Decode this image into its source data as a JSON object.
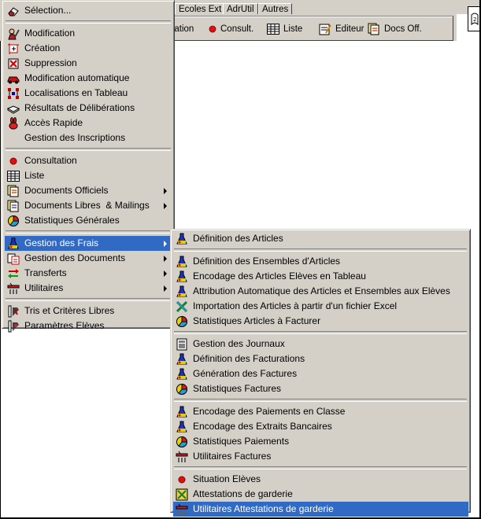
{
  "tabs": [
    {
      "label": "Ecoles Ext"
    },
    {
      "label": "AdrUtil"
    },
    {
      "label": "Autres"
    }
  ],
  "toolbar": {
    "creation_label": "éation",
    "consult_label": "Consult.",
    "liste_label": "Liste",
    "editeur_label": "Editeur",
    "docsoff_label": "Docs Off."
  },
  "main_menu": {
    "items": [
      {
        "label": "Sélection...",
        "icon": "eraser-icon"
      },
      {
        "label": "Modification",
        "icon": "modify-icon"
      },
      {
        "label": "Création",
        "icon": "create-icon"
      },
      {
        "label": "Suppression",
        "icon": "delete-icon"
      },
      {
        "label": "Modification automatique",
        "icon": "car-icon"
      },
      {
        "label": "Localisations en Tableau",
        "icon": "grid-location-icon"
      },
      {
        "label": "Résultats de Délibérations",
        "icon": "book-icon"
      },
      {
        "label": "Accès Rapide",
        "icon": "rabbit-icon"
      },
      {
        "label": "Gestion des Inscriptions",
        "icon": ""
      },
      {
        "label": "Consultation",
        "icon": "red-dot-icon"
      },
      {
        "label": "Liste",
        "icon": "list-icon"
      },
      {
        "label": "Documents Officiels",
        "icon": "documents-icon"
      },
      {
        "label": "Documents Libres  & Mailings",
        "icon": "documents-icon"
      },
      {
        "label": "Statistiques Générales",
        "icon": "pie-chart-icon"
      },
      {
        "label": "Gestion des Frais",
        "icon": "flask-icon"
      },
      {
        "label": "Gestion des Documents",
        "icon": "doc-manage-icon"
      },
      {
        "label": "Transferts",
        "icon": "transfer-arrows-icon"
      },
      {
        "label": "Utilitaires",
        "icon": "tools-icon"
      },
      {
        "label": "Tris et Critères Libres",
        "icon": "sort-icon"
      },
      {
        "label": "Paramètres Elèves",
        "icon": "settings-icon"
      }
    ]
  },
  "sub_menu": {
    "items": [
      {
        "label": "Définition des Articles",
        "icon": "flask-icon"
      },
      {
        "label": "Définition des Ensembles d'Articles",
        "icon": "flask-icon"
      },
      {
        "label": "Encodage des Articles Elèves en Tableau",
        "icon": "flask-icon"
      },
      {
        "label": "Attribution Automatique des Articles et Ensembles aux Elèves",
        "icon": "flask-icon"
      },
      {
        "label": "Importation des Articles à partir d'un fichier Excel",
        "icon": "excel-icon"
      },
      {
        "label": "Statistiques Articles à Facturer",
        "icon": "pie-chart-icon"
      },
      {
        "label": "Gestion des Journaux",
        "icon": "journal-icon"
      },
      {
        "label": "Définition des Facturations",
        "icon": "flask-icon"
      },
      {
        "label": "Génération des Factures",
        "icon": "flask-icon"
      },
      {
        "label": "Statistiques Factures",
        "icon": "pie-chart-icon"
      },
      {
        "label": "Encodage des Paiements en Classe",
        "icon": "flask-icon"
      },
      {
        "label": "Encodage des Extraits Bancaires",
        "icon": "flask-icon"
      },
      {
        "label": "Statistiques Paiements",
        "icon": "pie-chart-icon"
      },
      {
        "label": "Utilitaires Factures",
        "icon": "tools-icon"
      },
      {
        "label": "Situation Elèves",
        "icon": "red-dot-icon"
      },
      {
        "label": "Attestations de garderie",
        "icon": "attest-icon"
      },
      {
        "label": "Utilitaires Attestations de garderie",
        "icon": "tools-icon"
      }
    ]
  },
  "colors": {
    "highlight": "#316ac5",
    "menu_bg": "#d4d0c8"
  }
}
